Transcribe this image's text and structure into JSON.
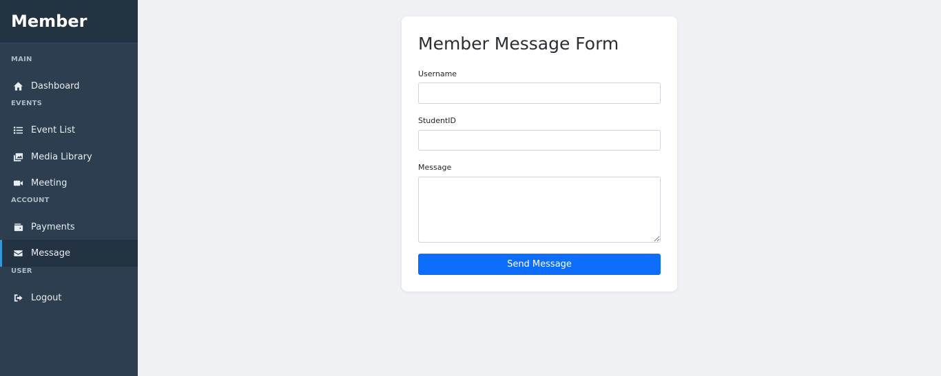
{
  "sidebar": {
    "brand": "Member",
    "sections": {
      "main": "MAIN",
      "events": "EVENTS",
      "account": "ACCOUNT",
      "user": "USER"
    },
    "items": {
      "dashboard": {
        "label": "Dashboard",
        "icon": "home-icon"
      },
      "event_list": {
        "label": "Event List",
        "icon": "list-icon"
      },
      "media_library": {
        "label": "Media Library",
        "icon": "images-icon"
      },
      "meeting": {
        "label": "Meeting",
        "icon": "video-icon"
      },
      "payments": {
        "label": "Payments",
        "icon": "wallet-icon"
      },
      "message": {
        "label": "Message",
        "icon": "envelope-icon",
        "active": true
      },
      "logout": {
        "label": "Logout",
        "icon": "sign-out-icon"
      }
    },
    "active_accent": "#3498db"
  },
  "form": {
    "title": "Member Message Form",
    "username": {
      "label": "Username",
      "value": "",
      "placeholder": ""
    },
    "student_id": {
      "label": "StudentID",
      "value": "",
      "placeholder": ""
    },
    "message": {
      "label": "Message",
      "value": "",
      "placeholder": ""
    },
    "submit_label": "Send Message",
    "submit_color": "#0d6efd"
  }
}
